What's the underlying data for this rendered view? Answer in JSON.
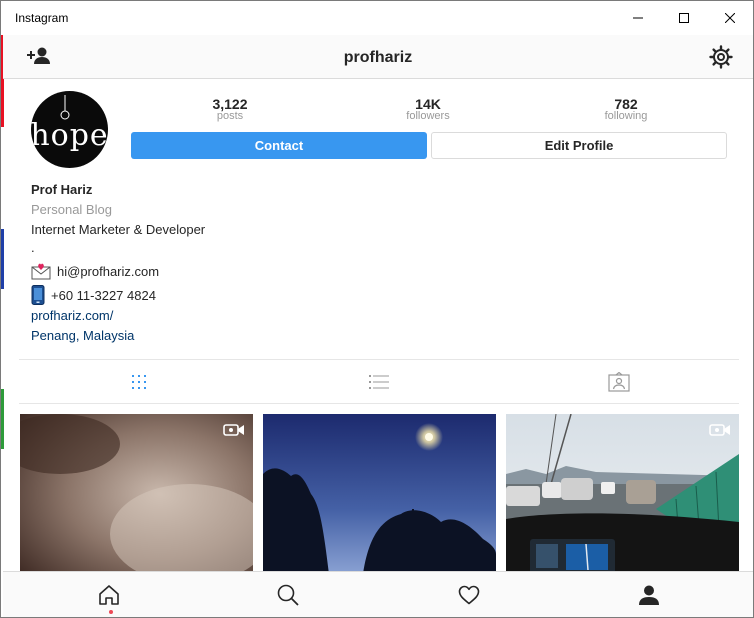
{
  "window": {
    "title": "Instagram"
  },
  "header": {
    "username": "profhariz"
  },
  "profile": {
    "stats": [
      {
        "value": "3,122",
        "label": "posts"
      },
      {
        "value": "14K",
        "label": "followers"
      },
      {
        "value": "782",
        "label": "following"
      }
    ],
    "contact_label": "Contact",
    "edit_label": "Edit Profile",
    "avatar_text": "hope",
    "name": "Prof Hariz",
    "category": "Personal Blog",
    "description": "Internet Marketer & Developer",
    "dot_line": ".",
    "email": "hi@profhariz.com",
    "phone": "+60 11-3227 4824",
    "website": "profhariz.com/",
    "location": "Penang, Malaysia"
  },
  "tabs": [
    "grid-icon",
    "list-icon",
    "tagged-icon"
  ],
  "grid": [
    {
      "name": "post-tile-1",
      "video": true
    },
    {
      "name": "post-tile-2",
      "video": false
    },
    {
      "name": "post-tile-3",
      "video": true
    }
  ],
  "nav": [
    "home-icon",
    "search-icon",
    "heart-icon",
    "profile-icon"
  ],
  "colors": {
    "accent": "#3897f0",
    "link": "#003569",
    "muted": "#999999",
    "border": "#dbdbdb"
  }
}
